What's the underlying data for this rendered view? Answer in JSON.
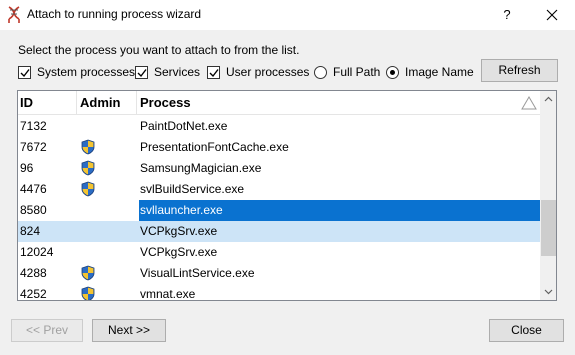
{
  "window": {
    "title": "Attach to running process wizard",
    "help_label": "?"
  },
  "instruction": "Select the process you want to attach to from the list.",
  "filters": {
    "system_processes": {
      "label": "System processes",
      "checked": true
    },
    "services": {
      "label": "Services",
      "checked": true
    },
    "user_processes": {
      "label": "User processes",
      "checked": true
    }
  },
  "display_mode": {
    "full_path": {
      "label": "Full Path",
      "selected": false
    },
    "image_name": {
      "label": "Image Name",
      "selected": true
    }
  },
  "refresh_label": "Refresh",
  "table": {
    "columns": [
      "ID",
      "Admin",
      "Process"
    ],
    "rows": [
      {
        "id": "7132",
        "admin": false,
        "process": "PaintDotNet.exe"
      },
      {
        "id": "7672",
        "admin": true,
        "process": "PresentationFontCache.exe"
      },
      {
        "id": "96",
        "admin": true,
        "process": "SamsungMagician.exe"
      },
      {
        "id": "4476",
        "admin": true,
        "process": "svlBuildService.exe"
      },
      {
        "id": "8580",
        "admin": false,
        "process": "svllauncher.exe",
        "selected": "strong"
      },
      {
        "id": "824",
        "admin": false,
        "process": "VCPkgSrv.exe",
        "selected": "light"
      },
      {
        "id": "12024",
        "admin": false,
        "process": "VCPkgSrv.exe"
      },
      {
        "id": "4288",
        "admin": true,
        "process": "VisualLintService.exe"
      },
      {
        "id": "4252",
        "admin": true,
        "process": "vmnat.exe"
      }
    ]
  },
  "buttons": {
    "prev": "<< Prev",
    "next": "Next >>",
    "close": "Close"
  },
  "colors": {
    "selection_strong": "#0a72d0",
    "selection_light": "#cde4f7"
  }
}
